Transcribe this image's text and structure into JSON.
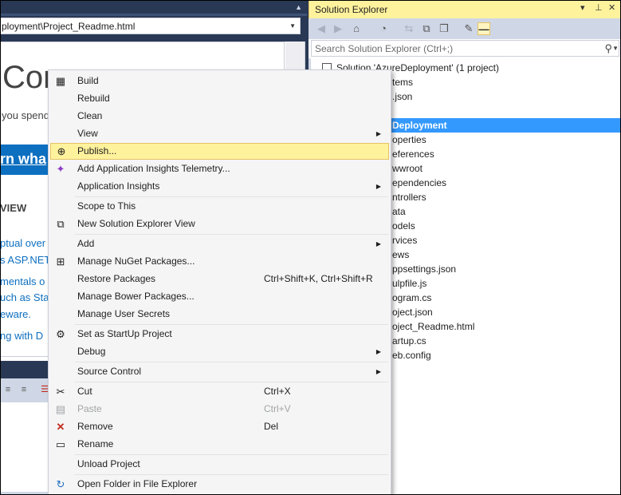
{
  "editor": {
    "address": "ployment\\Project_Readme.html",
    "page_title": "Con",
    "page_subtitle": "you spend",
    "banner_text": "rn wha",
    "section_head": "VIEW",
    "links": [
      "ptual over",
      "s ASP.NET",
      "mentals o",
      "uch as Sta",
      "eware.",
      "ng with D"
    ]
  },
  "solution_explorer": {
    "title": "Solution Explorer",
    "title_controls": {
      "dropdown": "▾",
      "pin": "⊥",
      "close": "✕"
    },
    "search_placeholder": "Search Solution Explorer (Ctrl+;)",
    "tree": [
      "Solution 'AzureDeployment' (1 project)",
      "tems",
      ".json",
      "",
      "Deployment",
      "operties",
      "eferences",
      "wwroot",
      "ependencies",
      "ntrollers",
      "ata",
      "odels",
      "rvices",
      "ews",
      "ppsettings.json",
      "ulpfile.js",
      "ogram.cs",
      "oject.json",
      "oject_Readme.html",
      "artup.cs",
      "eb.config"
    ]
  },
  "context_menu": {
    "items": [
      {
        "label": "Build",
        "icon": "build-icon"
      },
      {
        "label": "Rebuild"
      },
      {
        "label": "Clean"
      },
      {
        "label": "View",
        "submenu": true
      },
      {
        "label": "Publish...",
        "icon": "globe-icon",
        "highlighted": true
      },
      {
        "label": "Add Application Insights Telemetry...",
        "icon": "insights-icon"
      },
      {
        "label": "Application Insights",
        "submenu": true
      },
      {
        "label": "Scope to This"
      },
      {
        "label": "New Solution Explorer View",
        "icon": "new-view-icon"
      },
      {
        "label": "Add",
        "submenu": true
      },
      {
        "label": "Manage NuGet Packages...",
        "icon": "nuget-icon"
      },
      {
        "label": "Restore Packages",
        "shortcut": "Ctrl+Shift+K, Ctrl+Shift+R"
      },
      {
        "label": "Manage Bower Packages..."
      },
      {
        "label": "Manage User Secrets"
      },
      {
        "label": "Set as StartUp Project",
        "icon": "gear-icon"
      },
      {
        "label": "Debug",
        "submenu": true
      },
      {
        "label": "Source Control",
        "submenu": true
      },
      {
        "label": "Cut",
        "icon": "scissors-icon",
        "shortcut": "Ctrl+X"
      },
      {
        "label": "Paste",
        "icon": "paste-icon",
        "shortcut": "Ctrl+V",
        "disabled": true
      },
      {
        "label": "Remove",
        "icon": "remove-icon",
        "shortcut": "Del"
      },
      {
        "label": "Rename",
        "icon": "rename-icon"
      },
      {
        "label": "Unload Project"
      },
      {
        "label": "Open Folder in File Explorer",
        "icon": "refresh-folder-icon"
      }
    ]
  },
  "colors": {
    "highlight": "#fff29d",
    "selection": "#3399ff",
    "chrome_dark": "#293955",
    "link": "#0d6fc0"
  }
}
